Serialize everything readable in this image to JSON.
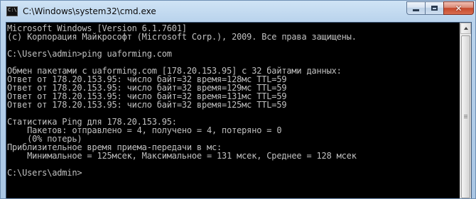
{
  "window": {
    "title": "C:\\Windows\\system32\\cmd.exe",
    "icon": "cmd-icon",
    "icon_text": "C:\\",
    "buttons": {
      "minimize_icon": "minimize-icon",
      "maximize_icon": "maximize-icon",
      "close_icon": "close-icon",
      "close_glyph": "✕"
    }
  },
  "console": {
    "lines": [
      "Microsoft Windows [Version 6.1.7601]",
      "(c) Корпорация Майкрософт (Microsoft Corp.), 2009. Все права защищены.",
      "",
      "C:\\Users\\admin>ping uaforming.com",
      "",
      "Обмен пакетами с uaforming.com [178.20.153.95] с 32 байтами данных:",
      "Ответ от 178.20.153.95: число байт=32 время=128мс TTL=59",
      "Ответ от 178.20.153.95: число байт=32 время=129мс TTL=59",
      "Ответ от 178.20.153.95: число байт=32 время=131мс TTL=59",
      "Ответ от 178.20.153.95: число байт=32 время=125мс TTL=59",
      "",
      "Статистика Ping для 178.20.153.95:",
      "    Пакетов: отправлено = 4, получено = 4, потеряно = 0",
      "    (0% потерь)",
      "Приблизительное время приема-передачи в мс:",
      "    Минимальное = 125мсек, Максимальное = 131 мсек, Среднее = 128 мсек",
      "",
      "C:\\Users\\admin>"
    ]
  },
  "colors": {
    "console_background": "#000000",
    "console_text": "#c0c0c0",
    "titlebar": "#b9d3ec",
    "close_button": "#c5482c"
  }
}
